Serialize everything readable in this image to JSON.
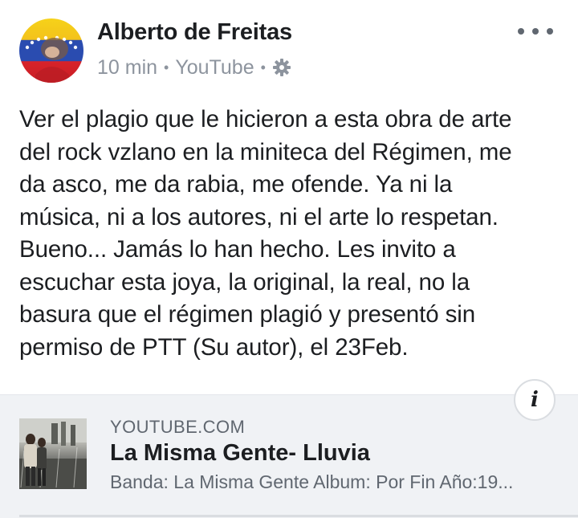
{
  "post": {
    "author": "Alberto de Freitas",
    "time": "10 min",
    "source": "YouTube",
    "audience_icon": "gear-icon",
    "more_icon": "more-options-icon",
    "text": "Ver el plagio que le hicieron a esta obra de arte\ndel rock vzlano en la miniteca del Régimen, me\nda asco, me da rabia, me ofende. Ya ni la\nmúsica, ni a los autores, ni el arte lo respetan.\nBueno... Jamás lo han hecho. Les invito a\nescuchar esta joya, la original, la real, no la\nbasura que el régimen plagió y presentó sin\npermiso de PTT (Su autor), el 23Feb."
  },
  "link_preview": {
    "domain": "YOUTUBE.COM",
    "title": "La Misma Gente- Lluvia",
    "description": "Banda: La Misma Gente Album: Por Fin Año:19...",
    "info_icon": "info-icon"
  },
  "colors": {
    "text": "#1c1e21",
    "secondary": "#8d949e",
    "card_bg": "#f0f2f5"
  }
}
